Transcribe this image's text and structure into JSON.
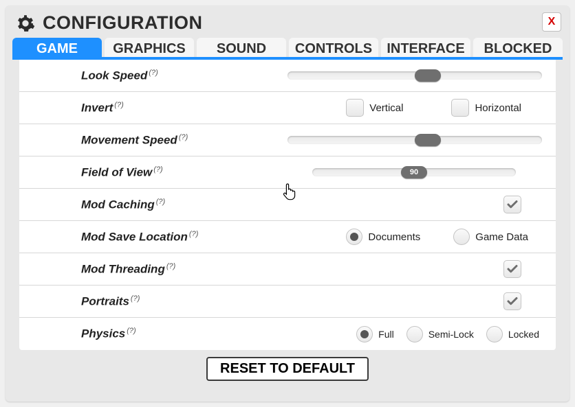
{
  "header": {
    "title": "CONFIGURATION",
    "close_label": "X"
  },
  "tabs": [
    {
      "label": "GAME",
      "active": true
    },
    {
      "label": "GRAPHICS",
      "active": false
    },
    {
      "label": "SOUND",
      "active": false
    },
    {
      "label": "CONTROLS",
      "active": false
    },
    {
      "label": "INTERFACE",
      "active": false
    },
    {
      "label": "BLOCKED",
      "active": false
    }
  ],
  "help_hint": "(?)",
  "rows": {
    "look_speed": {
      "label": "Look Speed",
      "value_pct": 55
    },
    "invert": {
      "label": "Invert",
      "vertical_label": "Vertical",
      "horizontal_label": "Horizontal",
      "vertical": false,
      "horizontal": false
    },
    "movement_speed": {
      "label": "Movement Speed",
      "value_pct": 55
    },
    "fov": {
      "label": "Field of View",
      "value": "90",
      "value_pct": 50
    },
    "mod_caching": {
      "label": "Mod Caching",
      "checked": true
    },
    "mod_save": {
      "label": "Mod Save Location",
      "opt_documents": "Documents",
      "opt_gamedata": "Game Data",
      "selected": "documents"
    },
    "mod_threading": {
      "label": "Mod Threading",
      "checked": true
    },
    "portraits": {
      "label": "Portraits",
      "checked": true
    },
    "physics": {
      "label": "Physics",
      "opt_full": "Full",
      "opt_semi": "Semi-Lock",
      "opt_locked": "Locked",
      "selected": "full"
    }
  },
  "footer": {
    "reset_label": "RESET TO DEFAULT"
  }
}
